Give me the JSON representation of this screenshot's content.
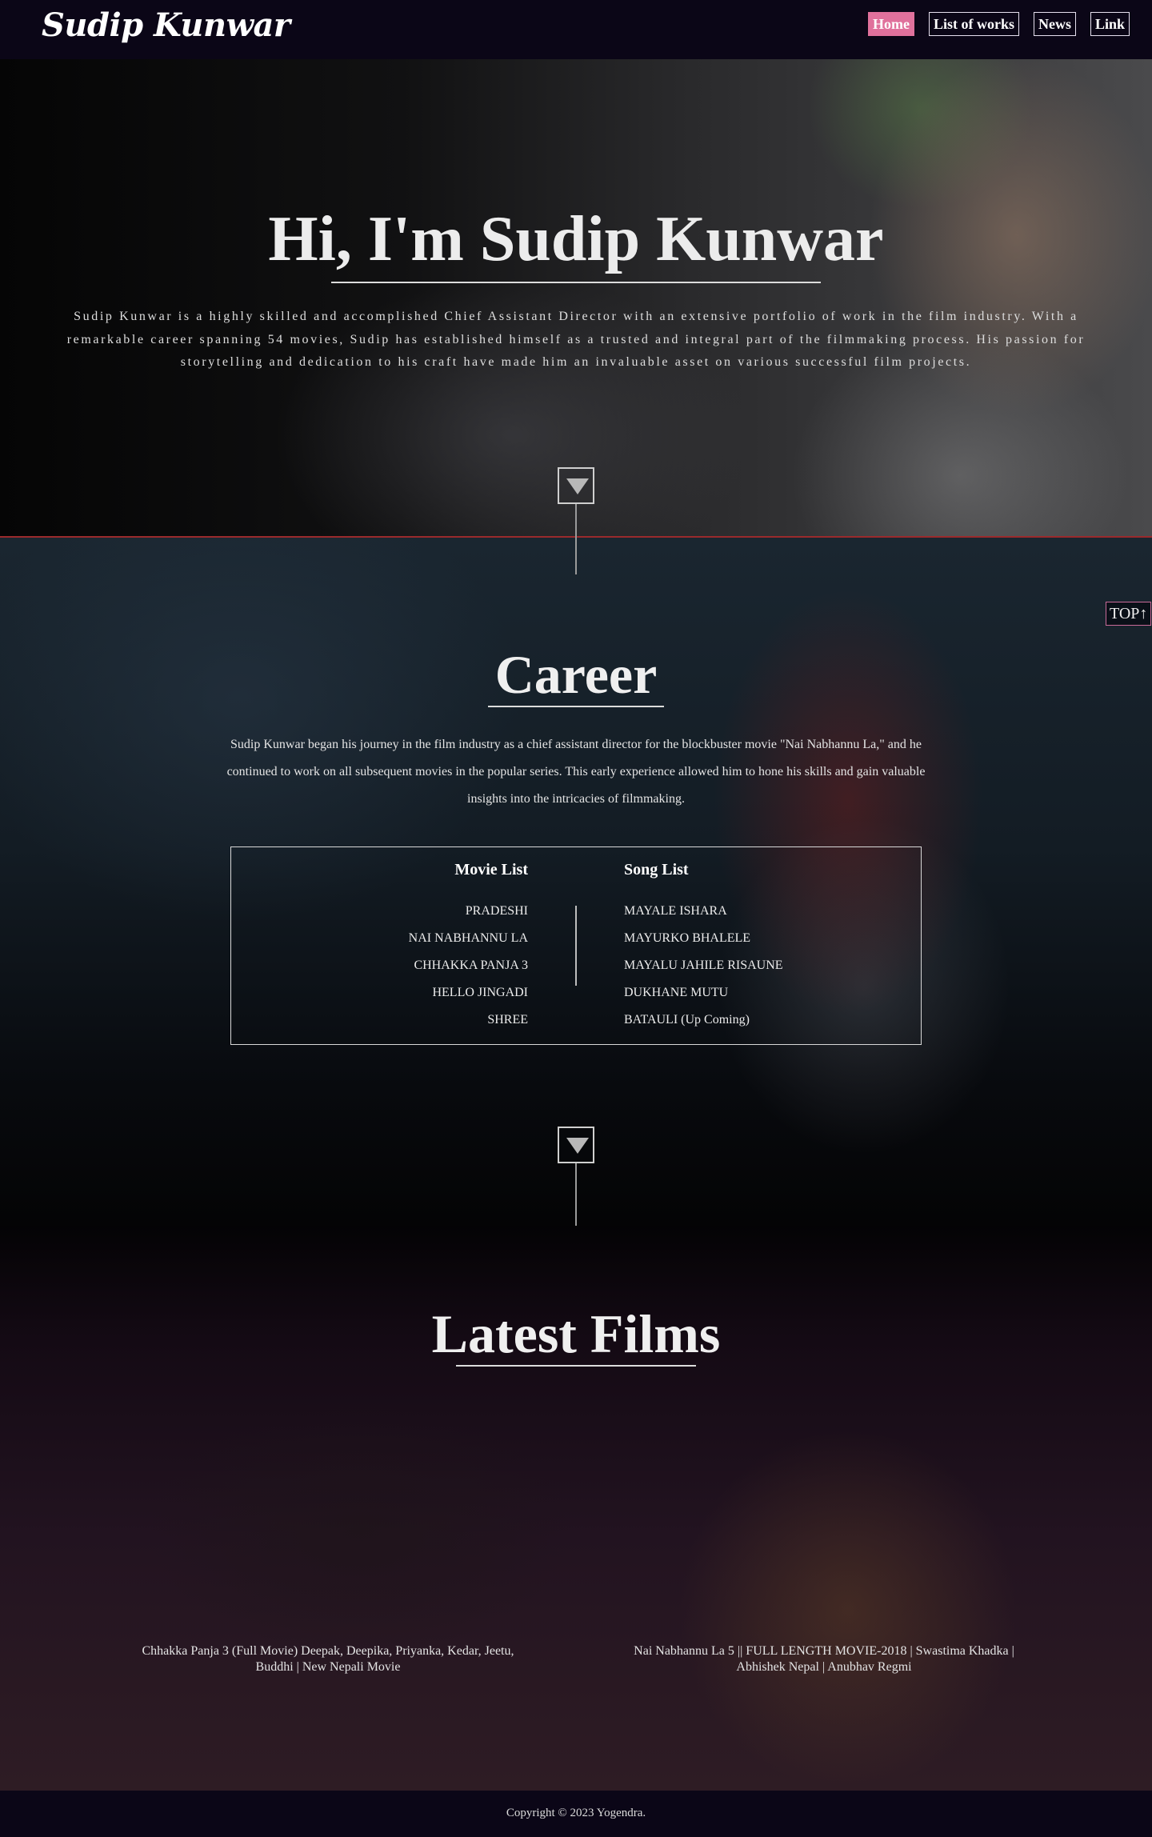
{
  "nav": {
    "brand": "Sudip Kunwar",
    "links": [
      {
        "label": "Home",
        "active": true
      },
      {
        "label": "List of works",
        "active": false
      },
      {
        "label": "News",
        "active": false
      },
      {
        "label": "Link",
        "active": false
      }
    ]
  },
  "hero": {
    "title": "Hi, I'm Sudip Kunwar",
    "text": "Sudip Kunwar is a highly skilled and accomplished Chief Assistant Director with an extensive portfolio of work in the film industry. With a remarkable career spanning 54 movies, Sudip has established himself as a trusted and integral part of the filmmaking process. His passion for storytelling and dedication to his craft have made him an invaluable asset on various successful film projects."
  },
  "top_button": "TOP↑",
  "career": {
    "title": "Career",
    "text": "Sudip Kunwar began his journey in the film industry as a chief assistant director for the blockbuster movie \"Nai Nabhannu La,\" and he continued to work on all subsequent movies in the popular series. This early experience allowed him to hone his skills and gain valuable insights into the intricacies of filmmaking.",
    "movie_list": {
      "heading": "Movie List",
      "items": [
        "PRADESHI",
        "NAI NABHANNU LA",
        "CHHAKKA PANJA 3",
        "HELLO JINGADI",
        "SHREE"
      ]
    },
    "song_list": {
      "heading": "Song List",
      "items": [
        "MAYALE ISHARA",
        "MAYURKO BHALELE",
        "MAYALU JAHILE RISAUNE",
        "DUKHANE MUTU",
        "BATAULI (Up Coming)"
      ]
    }
  },
  "latest_films": {
    "title": "Latest Films",
    "films": [
      {
        "caption": "Chhakka Panja 3 (Full Movie) Deepak, Deepika, Priyanka, Kedar, Jeetu, Buddhi | New Nepali Movie"
      },
      {
        "caption": "Nai Nabhannu La 5 || FULL LENGTH MOVIE-2018 | Swastima Khadka | Abhishek Nepal | Anubhav Regmi"
      }
    ]
  },
  "footer": {
    "copyright": "Copyright © 2023 Yogendra."
  },
  "colors": {
    "nav_bg": "#0b0617",
    "active_link": "#e0719c",
    "hero_divider": "#9a2a2c"
  }
}
